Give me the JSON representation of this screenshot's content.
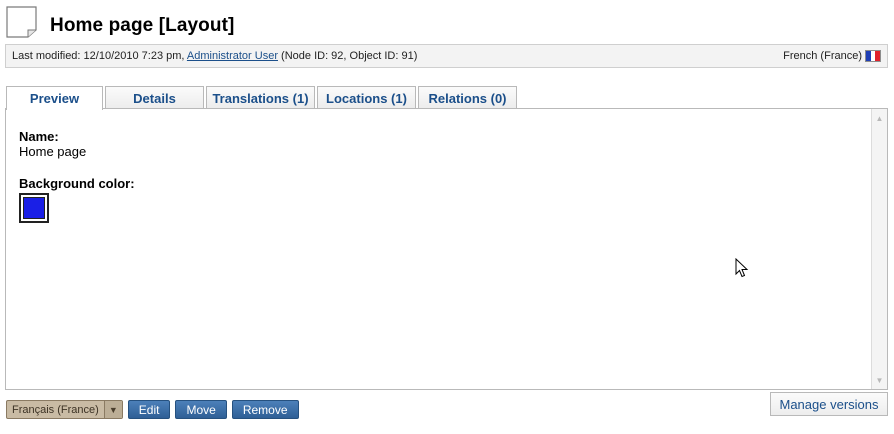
{
  "header": {
    "icon": "document-icon",
    "title": "Home page [Layout]"
  },
  "info_bar": {
    "last_modified_prefix": "Last modified: 12/10/2010 7:23 pm,",
    "author": "Administrator User",
    "ids": "(Node ID: 92, Object ID: 91)",
    "language": "French (France)",
    "flag_colors": [
      "#1f3fb5",
      "#ffffff",
      "#e0222b"
    ]
  },
  "tabs": [
    {
      "label": "Preview",
      "active": true
    },
    {
      "label": "Details",
      "active": false
    },
    {
      "label": "Translations (1)",
      "active": false
    },
    {
      "label": "Locations (1)",
      "active": false
    },
    {
      "label": "Relations (0)",
      "active": false
    }
  ],
  "preview": {
    "name_label": "Name:",
    "name_value": "Home page",
    "background_label": "Background color:",
    "background_color": "#1a1fe6"
  },
  "actions": {
    "language_select": "Français (France)",
    "edit": "Edit",
    "move": "Move",
    "remove": "Remove",
    "manage_versions": "Manage versions"
  }
}
